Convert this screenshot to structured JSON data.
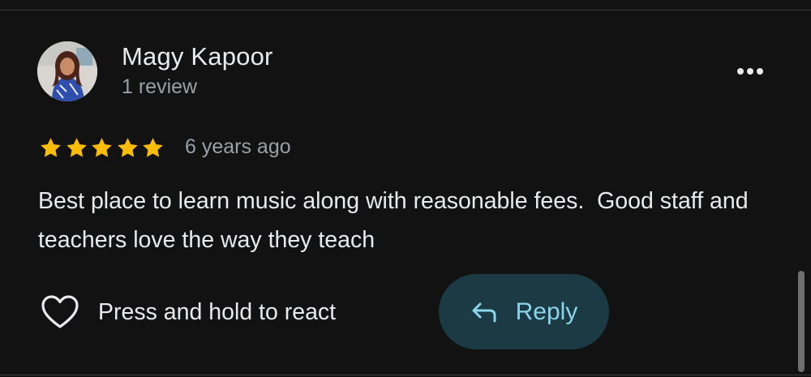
{
  "review": {
    "reviewer_name": "Magy Kapoor",
    "review_count": "1 review",
    "rating": 5,
    "rating_max": 5,
    "star_color": "#fbbc04",
    "timestamp": "6 years ago",
    "text": "Best place to learn music along with reasonable fees.  Good staff and teachers love the way they teach"
  },
  "actions": {
    "react_label": "Press and hold to react",
    "react_icon": "heart-outline-icon",
    "reply_label": "Reply",
    "reply_icon": "reply-arrow-icon",
    "more_icon": "more-horizontal-icon",
    "reply_bg_color": "#1c3a44",
    "reply_text_color": "#8ad4ec"
  }
}
